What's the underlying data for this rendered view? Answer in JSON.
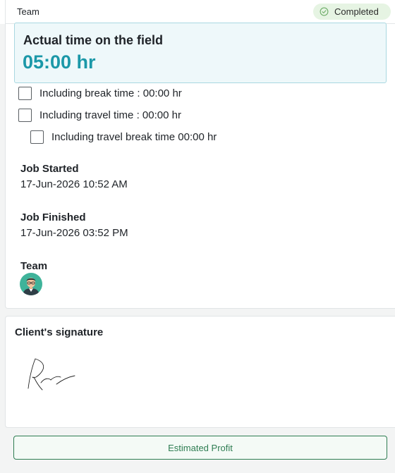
{
  "header": {
    "title": "Team",
    "status": {
      "label": "Completed",
      "icon": "check-circle-icon",
      "color": "#e6f4e3"
    }
  },
  "time_summary": {
    "title": "Actual time on the field",
    "value": "05:00 hr",
    "accent_color": "#1b98a8"
  },
  "time_options": [
    {
      "label": "Including break time : 00:00 hr",
      "checked": false
    },
    {
      "label": "Including travel time : 00:00 hr",
      "checked": false
    },
    {
      "label": "Including travel break time 00:00 hr",
      "checked": false
    }
  ],
  "job_started": {
    "label": "Job Started",
    "value": "17-Jun-2026 10:52 AM"
  },
  "job_finished": {
    "label": "Job Finished",
    "value": "17-Jun-2026 03:52 PM"
  },
  "team": {
    "label": "Team",
    "avatar_icon": "user-avatar-icon"
  },
  "signature": {
    "title": "Client's signature"
  },
  "actions": {
    "estimated_profit_label": "Estimated Profit",
    "accent_color": "#2e7d52"
  }
}
